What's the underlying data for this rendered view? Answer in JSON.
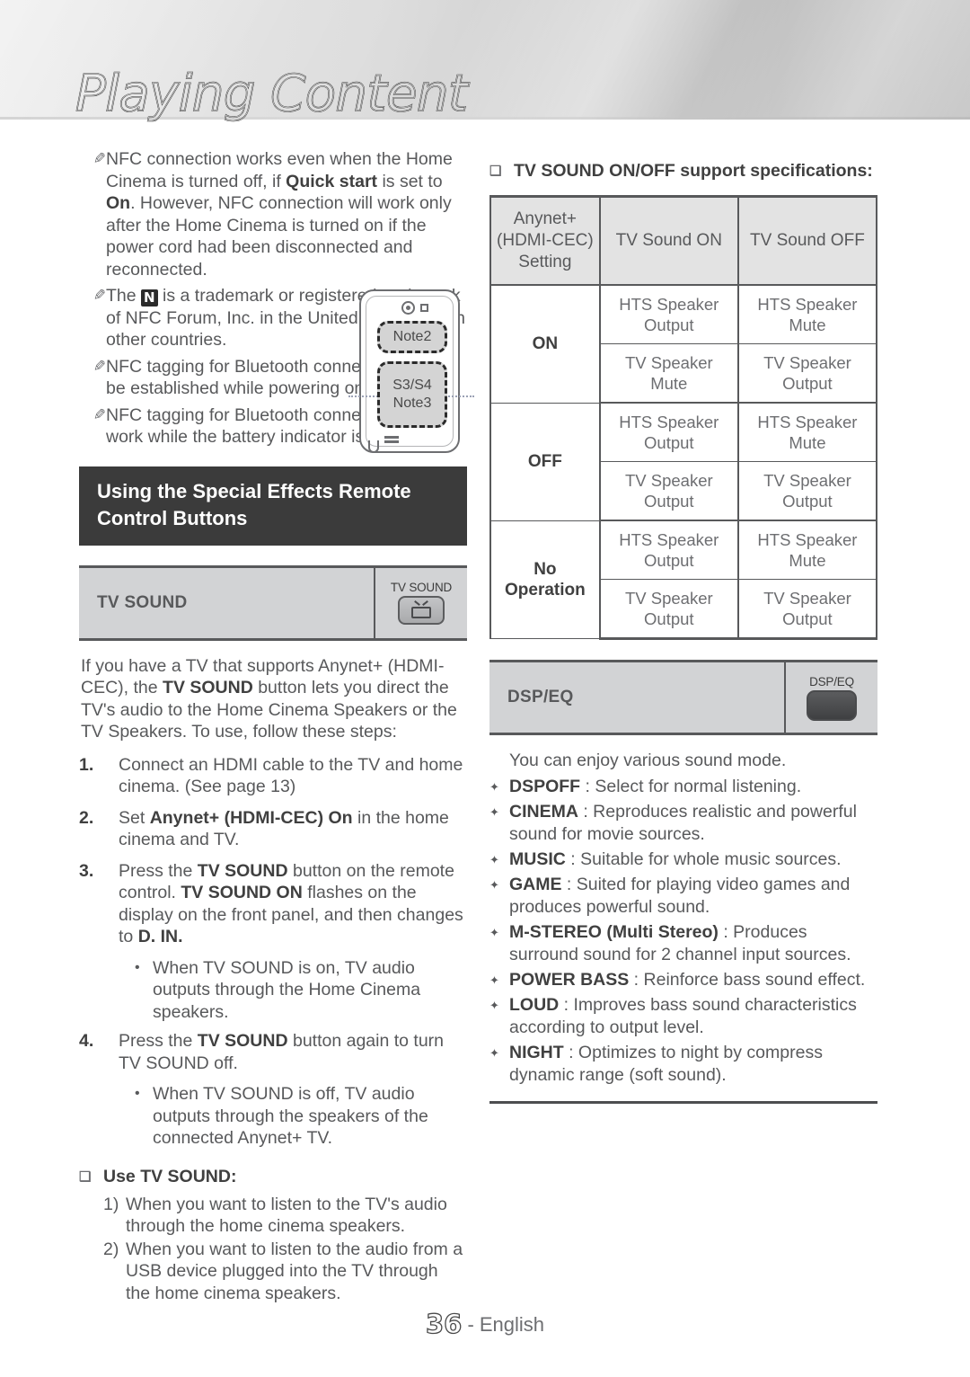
{
  "header": {
    "title": "Playing Content"
  },
  "left": {
    "notes": [
      "NFC connection works even when the Home Cinema is turned off, if <b>Quick start</b> is set to <b>On</b>. However, NFC connection will work only after the Home Cinema is turned on if the power cord had been disconnected and reconnected.",
      "The <span class=\"nlogo\">N</span> is a trademark or registered trademark of NFC Forum, Inc. in the United States and in other countries.",
      "NFC tagging for Bluetooth connection cannot be established while powering on and off.",
      "NFC tagging for Bluetooth connection will not work while the battery indicator is blinking."
    ],
    "phone": {
      "tag_top": "Note2",
      "tag_bottom_line1": "S3/S4",
      "tag_bottom_line2": "Note3"
    },
    "section_heading": "Using the Special Effects Remote Control Buttons",
    "tv_sound_strip": {
      "label": "TV SOUND",
      "key_label": "TV SOUND"
    },
    "body_copy": "If you have a TV that supports Anynet+ (HDMI-CEC), the <b>TV SOUND</b> button lets you direct the TV's audio to the Home Cinema Speakers or the TV Speakers. To use, follow these steps:",
    "steps": [
      {
        "num": "1.",
        "text": "Connect an HDMI cable to the TV and home cinema. (See page 13)",
        "sub": []
      },
      {
        "num": "2.",
        "text": "Set <b>Anynet+ (HDMI-CEC) On</b> in the home cinema and TV.",
        "sub": []
      },
      {
        "num": "3.",
        "text": "Press the <b>TV SOUND</b> button on the remote control. <b>TV SOUND ON</b> flashes on the display on the front panel, and then changes to <b>D. IN.</b>",
        "sub": [
          "When TV SOUND is on, TV audio outputs through the Home Cinema speakers."
        ]
      },
      {
        "num": "4.",
        "text": "Press the <b>TV SOUND</b> button again to turn TV SOUND off.",
        "sub": [
          "When TV SOUND is off, TV audio outputs through the speakers of the connected Anynet+ TV."
        ]
      }
    ],
    "use_tv_sound": {
      "heading": "Use TV SOUND:",
      "items": [
        {
          "num": "1)",
          "text": "When you want to listen to the TV's audio through the home cinema speakers."
        },
        {
          "num": "2)",
          "text": "When you want to listen to the audio from a USB device plugged into the TV through the home cinema speakers."
        }
      ]
    }
  },
  "right": {
    "table_heading": "TV SOUND ON/OFF support specifications:",
    "table": {
      "columns": [
        "Anynet+\n(HDMI-CEC)\nSetting",
        "TV Sound ON",
        "TV Sound OFF"
      ],
      "col0_line1": "Anynet+",
      "col0_line2": "(HDMI-CEC)",
      "col0_line3": "Setting",
      "col1": "TV Sound ON",
      "col2": "TV Sound OFF",
      "groups": [
        {
          "setting": "ON",
          "rows": [
            {
              "on": "HTS Speaker\nOutput",
              "off": "HTS Speaker\nMute",
              "on_l1": "HTS Speaker",
              "on_l2": "Output",
              "off_l1": "HTS Speaker",
              "off_l2": "Mute"
            },
            {
              "on": "TV Speaker\nMute",
              "off": "TV Speaker\nOutput",
              "on_l1": "TV Speaker",
              "on_l2": "Mute",
              "off_l1": "TV Speaker",
              "off_l2": "Output"
            }
          ]
        },
        {
          "setting": "OFF",
          "rows": [
            {
              "on_l1": "HTS Speaker",
              "on_l2": "Output",
              "off_l1": "HTS Speaker",
              "off_l2": "Mute"
            },
            {
              "on_l1": "TV Speaker",
              "on_l2": "Output",
              "off_l1": "TV Speaker",
              "off_l2": "Output"
            }
          ]
        },
        {
          "setting_l1": "No",
          "setting_l2": "Operation",
          "rows": [
            {
              "on_l1": "HTS Speaker",
              "on_l2": "Output",
              "off_l1": "HTS Speaker",
              "off_l2": "Mute"
            },
            {
              "on_l1": "TV Speaker",
              "on_l2": "Output",
              "off_l1": "TV Speaker",
              "off_l2": "Output"
            }
          ]
        }
      ]
    },
    "dspeq_strip": {
      "label": "DSP/EQ",
      "key_label": "DSP/EQ"
    },
    "dspeq_intro": "You can enjoy various sound mode.",
    "modes": [
      {
        "name": "DSPOFF",
        "desc": ": Select for normal listening."
      },
      {
        "name": "CINEMA",
        "desc": ": Reproduces realistic and powerful sound for movie sources."
      },
      {
        "name": "MUSIC",
        "desc": ": Suitable for whole music sources."
      },
      {
        "name": "GAME",
        "desc": ": Suited for playing video games and produces powerful sound."
      },
      {
        "name": "M-STEREO (Multi Stereo)",
        "desc": ": Produces surround sound for 2 channel input sources."
      },
      {
        "name": "POWER BASS",
        "desc": ": Reinforce bass sound effect."
      },
      {
        "name": "LOUD",
        "desc": ": Improves bass sound characteristics according to output level."
      },
      {
        "name": "NIGHT",
        "desc": ": Optimizes to night by compress dynamic range (soft sound)."
      }
    ]
  },
  "footer": {
    "page_number": "36",
    "language": "- English"
  },
  "icons": {
    "pencil": "✎",
    "square_bullet": "❑",
    "round_bullet": "•",
    "diamond_bullet": "✦"
  }
}
